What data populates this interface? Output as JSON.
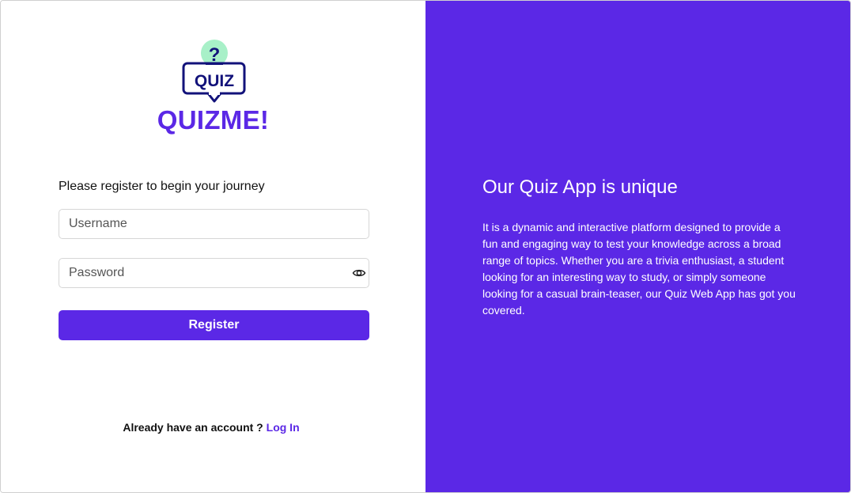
{
  "brand": {
    "logo_text": "QUIZ",
    "logo_mark": "?",
    "name": "QUIZME!",
    "logo_icon": "quiz-speech-bubble-icon"
  },
  "register_form": {
    "intro": "Please register to begin your journey",
    "username_placeholder": "Username",
    "username_value": "",
    "password_placeholder": "Password",
    "password_value": "",
    "password_toggle_icon": "eye-icon",
    "submit_label": "Register",
    "login_prompt": "Already have an account ?",
    "login_link": "Log In"
  },
  "promo": {
    "title": "Our Quiz App is unique",
    "body": "It is a dynamic and interactive platform designed to provide a fun and engaging way to test your knowledge across a broad range of topics. Whether you are a trivia enthusiast, a student looking for an interesting way to study, or simply someone looking for a casual brain-teaser, our Quiz Web App has got you covered."
  },
  "colors": {
    "accent": "#5b28e6",
    "logo_navy": "#12127a",
    "logo_mint": "#a8f0c8",
    "field_border": "#d6d6d6"
  }
}
